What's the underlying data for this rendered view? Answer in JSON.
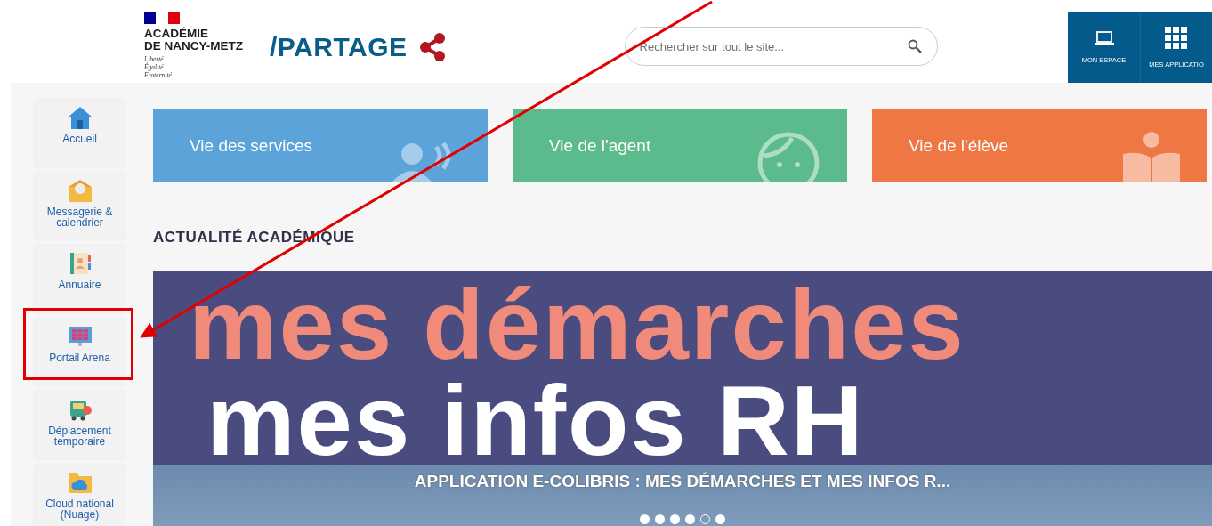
{
  "header": {
    "brand": {
      "marianne_lines": [
        "Liberté",
        "Égalité",
        "Fraternité"
      ],
      "academy_lines": [
        "ACADÉMIE",
        "DE NANCY-METZ"
      ]
    },
    "site_name": "/PARTAGE",
    "search": {
      "placeholder": "Rechercher sur tout le site..."
    },
    "shortcuts": [
      {
        "kind": "laptop",
        "label": "MON ESPACE"
      },
      {
        "kind": "grid",
        "label": "MES APPLICATIO"
      }
    ]
  },
  "sidebar": {
    "items": [
      {
        "kind": "home",
        "label": "Accueil",
        "highlighted": false
      },
      {
        "kind": "mail",
        "label": "Messagerie & calendrier",
        "highlighted": false
      },
      {
        "kind": "book",
        "label": "Annuaire",
        "highlighted": false
      },
      {
        "kind": "screen",
        "label": "Portail Arena",
        "highlighted": true
      },
      {
        "kind": "bus",
        "label": "Déplacement temporaire",
        "highlighted": false
      },
      {
        "kind": "cloud",
        "label": "Cloud national (Nuage)",
        "highlighted": false
      }
    ]
  },
  "tiles": [
    {
      "kind": "services",
      "label": "Vie des services",
      "color": "#5ba3d9"
    },
    {
      "kind": "agent",
      "label": "Vie de l'agent",
      "color": "#5bbb8c"
    },
    {
      "kind": "eleve",
      "label": "Vie de l'élève",
      "color": "#ee7744"
    }
  ],
  "news": {
    "heading": "ACTUALITÉ ACADÉMIQUE",
    "banner_lines": [
      "mes démarches",
      "mes infos RH"
    ],
    "caption": "APPLICATION E-COLIBRIS : MES DÉMARCHES ET MES INFOS R...",
    "dots": [
      {
        "selected": false
      },
      {
        "selected": false
      },
      {
        "selected": false
      },
      {
        "selected": false
      },
      {
        "selected": true
      },
      {
        "selected": false
      }
    ]
  }
}
